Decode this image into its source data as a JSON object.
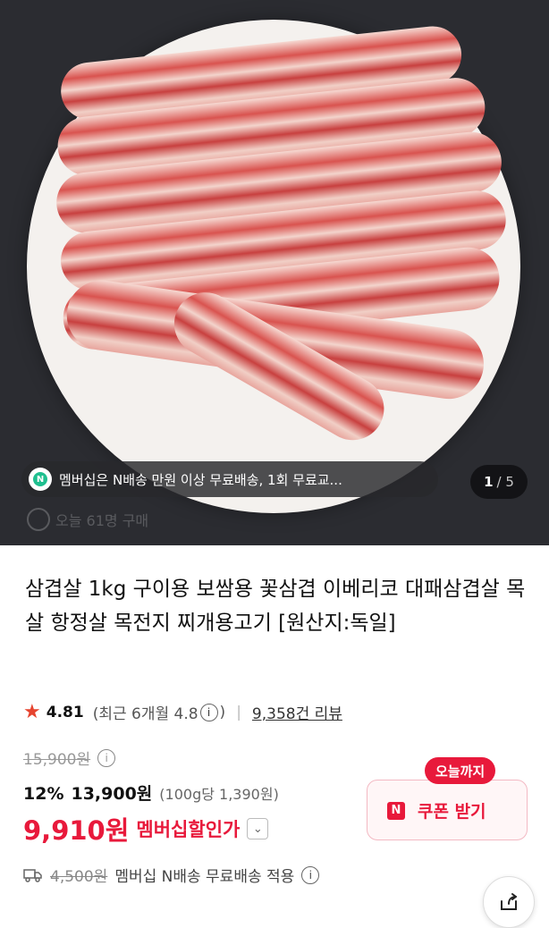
{
  "hero": {
    "image_alt": "삼겹살 사진",
    "toast_text": "멤버십은 N배송 만원 이상 무료배송, 1회 무료교...",
    "toast_icon": "n-membership-icon",
    "counter_current": "1",
    "counter_total": "/ 5",
    "buyers_text": "오늘 61명 구매"
  },
  "product": {
    "title": "삼겹살 1kg 구이용 보쌈용 꽃삼겹 이베리코 대패삼겹살 목살 항정살 목전지 찌개용고기 [원산지:독일]"
  },
  "rating": {
    "score": "4.81",
    "recent": "(최근 6개월 4.8",
    "recent_close": ")",
    "review_count": "9,358건 리뷰"
  },
  "price": {
    "original": "15,900원",
    "discount": "12%",
    "sale": "13,900원",
    "unit": "(100g당 1,390원)",
    "member_price": "9,910원",
    "member_label": "멤버십할인가"
  },
  "coupon": {
    "tag": "오늘까지",
    "badge": "N",
    "label": "쿠폰 받기"
  },
  "shipping": {
    "original_fee": "4,500원",
    "text": "멤버십 N배송 무료배송 적용"
  },
  "colors": {
    "accent": "#e8193b",
    "star": "#e6442f",
    "hero_bg": "#2b2c31"
  }
}
